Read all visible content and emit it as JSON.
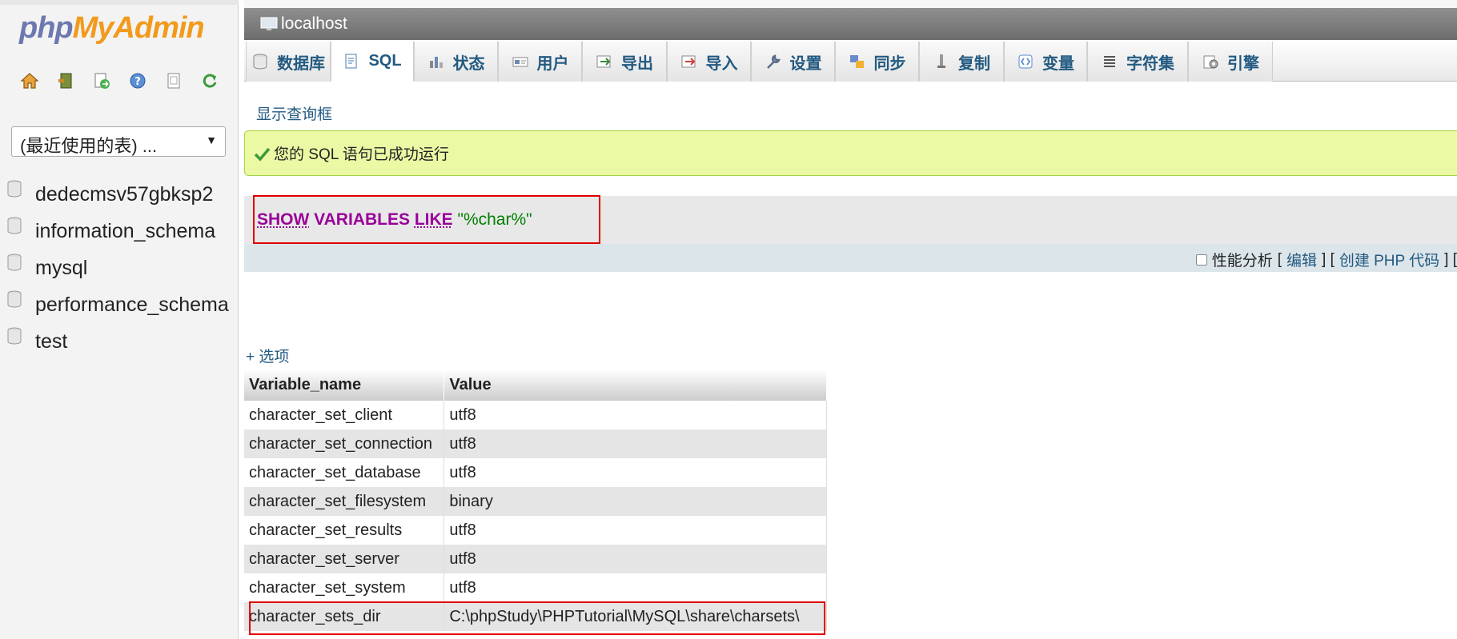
{
  "app": {
    "logo_part1": "php",
    "logo_part2": "MyAdmin",
    "nav_icons": [
      "home-icon",
      "exit-icon",
      "sql-query-icon",
      "help-icon",
      "docs-icon",
      "reload-icon"
    ]
  },
  "navigation": {
    "recent_tables": "(最近使用的表) ...",
    "databases": [
      "dedecmsv57gbksp2",
      "information_schema",
      "mysql",
      "performance_schema",
      "test"
    ]
  },
  "server_bar": {
    "title": "localhost"
  },
  "tabs": [
    {
      "label": "数据库",
      "icon": "database-icon"
    },
    {
      "label": "SQL",
      "icon": "sql-icon"
    },
    {
      "label": "状态",
      "icon": "status-icon"
    },
    {
      "label": "用户",
      "icon": "users-icon"
    },
    {
      "label": "导出",
      "icon": "export-icon"
    },
    {
      "label": "导入",
      "icon": "import-icon"
    },
    {
      "label": "设置",
      "icon": "settings-icon"
    },
    {
      "label": "同步",
      "icon": "sync-icon"
    },
    {
      "label": "复制",
      "icon": "replication-icon"
    },
    {
      "label": "变量",
      "icon": "variables-icon"
    },
    {
      "label": "字符集",
      "icon": "charset-icon"
    },
    {
      "label": "引擎",
      "icon": "engine-icon"
    }
  ],
  "active_tab": "SQL",
  "show_query_link": "显示查询框",
  "success_message": "您的 SQL 语句已成功运行",
  "sql": {
    "kw_show": "SHOW",
    "kw_variables": "VARIABLES",
    "kw_like": "LIKE",
    "string": "\"%char%\""
  },
  "sql_footer": {
    "profiling": "性能分析",
    "bracket_open": "[",
    "edit": "编辑",
    "sep": "] [",
    "create_php": "创建 PHP 代码",
    "bracket_close": "] ["
  },
  "options_link": "+ 选项",
  "results": {
    "columns": [
      "Variable_name",
      "Value"
    ],
    "rows": [
      [
        "character_set_client",
        "utf8"
      ],
      [
        "character_set_connection",
        "utf8"
      ],
      [
        "character_set_database",
        "utf8"
      ],
      [
        "character_set_filesystem",
        "binary"
      ],
      [
        "character_set_results",
        "utf8"
      ],
      [
        "character_set_server",
        "utf8"
      ],
      [
        "character_set_system",
        "utf8"
      ],
      [
        "character_sets_dir",
        "C:\\phpStudy\\PHPTutorial\\MySQL\\share\\charsets\\"
      ]
    ]
  },
  "colors": {
    "link": "#235a81",
    "success_bg": "#ebf8a4",
    "highlight_border": "#e00000",
    "keyword": "#990099",
    "string": "#008000"
  }
}
